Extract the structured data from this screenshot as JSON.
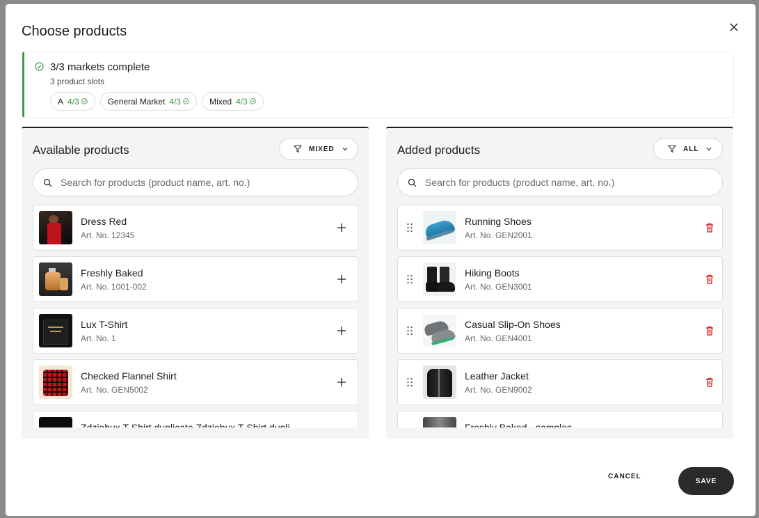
{
  "dialog": {
    "title": "Choose products"
  },
  "markets": {
    "title": "3/3 markets complete",
    "subtitle": "3 product slots",
    "chips": [
      {
        "name": "A",
        "count": "4/3"
      },
      {
        "name": "General Market",
        "count": "4/3"
      },
      {
        "name": "Mixed",
        "count": "4/3"
      }
    ]
  },
  "available": {
    "title": "Available products",
    "filter": "MIXED",
    "search_placeholder": "Search for products (product name, art. no.)",
    "items": [
      {
        "name": "Dress Red",
        "art": "Art. No. 12345",
        "thumb": "red-dress"
      },
      {
        "name": "Freshly Baked",
        "art": "Art. No. 1001-002",
        "thumb": "perfume-bottle"
      },
      {
        "name": "Lux T-Shirt",
        "art": "Art. No. 1",
        "thumb": "black-tshirt"
      },
      {
        "name": "Checked Flannel Shirt",
        "art": "Art. No. GEN5002",
        "thumb": "flannel-shirt"
      },
      {
        "name": "Zdziebux T-Shirt duplicate Zdziebux T-Shirt dupli...",
        "art": "",
        "thumb": "black-tshirt-dark"
      }
    ]
  },
  "added": {
    "title": "Added products",
    "filter": "ALL",
    "search_placeholder": "Search for products (product name, art. no.)",
    "items": [
      {
        "name": "Running Shoes",
        "art": "Art. No. GEN2001",
        "thumb": "blue-sneaker"
      },
      {
        "name": "Hiking Boots",
        "art": "Art. No. GEN3001",
        "thumb": "black-boots"
      },
      {
        "name": "Casual Slip-On Shoes",
        "art": "Art. No. GEN4001",
        "thumb": "grey-sneakers"
      },
      {
        "name": "Leather Jacket",
        "art": "Art. No. GEN9002",
        "thumb": "leather-jacket"
      },
      {
        "name": "Freshly Baked - samples",
        "art": "",
        "thumb": "perfume-samples"
      }
    ]
  },
  "footer": {
    "cancel": "CANCEL",
    "save": "SAVE"
  },
  "colors": {
    "success": "#3a9a46",
    "primary_dark": "#2a2a2a",
    "danger": "#d32f2f"
  }
}
